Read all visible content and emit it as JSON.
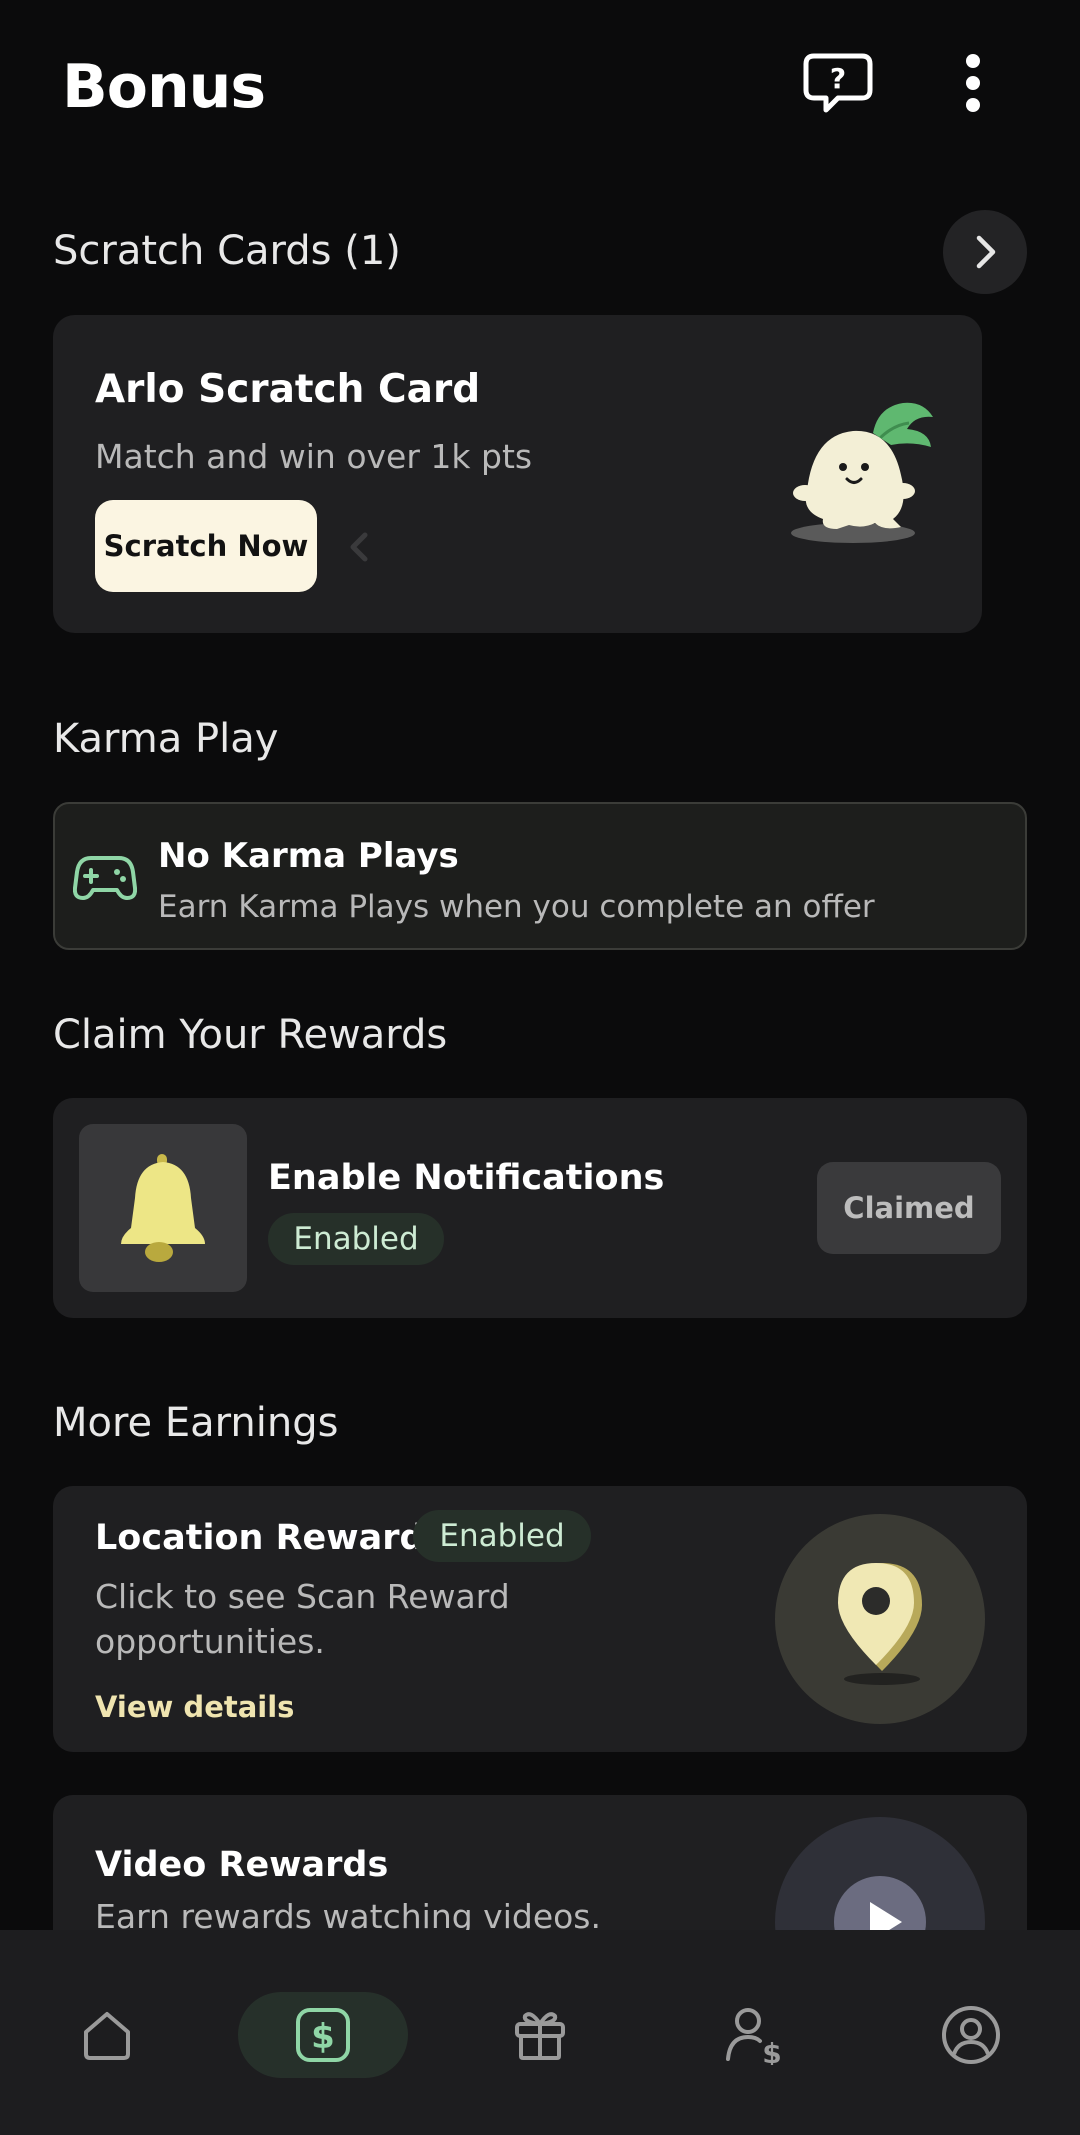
{
  "header": {
    "title": "Bonus",
    "help_icon": "help-chat-icon",
    "menu_icon": "more-vertical-icon"
  },
  "scratch_section": {
    "title": "Scratch Cards (1)",
    "chevron_icon": "chevron-right-icon",
    "card": {
      "title": "Arlo Scratch Card",
      "subtitle": "Match and win over 1k pts",
      "button_label": "Scratch Now",
      "mascot_icon": "radish-mascot-icon"
    }
  },
  "karma_section": {
    "title": "Karma Play",
    "box_title": "No Karma Plays",
    "box_subtitle": "Earn Karma Plays when you complete an offer",
    "icon": "gamepad-icon"
  },
  "rewards_section": {
    "title": "Claim Your Rewards",
    "item": {
      "title": "Enable Notifications",
      "badge": "Enabled",
      "button_label": "Claimed",
      "icon": "bell-icon"
    }
  },
  "earnings_section": {
    "title": "More Earnings",
    "location": {
      "title": "Location Rewards",
      "badge": "Enabled",
      "subtitle": "Click to see Scan Reward opportunities.",
      "link": "View details",
      "icon": "map-pin-icon"
    },
    "video": {
      "title": "Video Rewards",
      "subtitle": "Earn rewards watching videos.",
      "icon": "play-icon"
    }
  },
  "bottom_nav": {
    "items": [
      {
        "icon": "home-icon",
        "active": false
      },
      {
        "icon": "dollar-icon",
        "active": true
      },
      {
        "icon": "gift-icon",
        "active": false
      },
      {
        "icon": "user-dollar-icon",
        "active": false
      },
      {
        "icon": "profile-icon",
        "active": false
      }
    ]
  },
  "colors": {
    "background": "#0b0b0c",
    "card": "#1f1f21",
    "accent_green": "#8fd6a6",
    "accent_cream": "#fbf5e2",
    "link_yellow": "#efe4b0"
  }
}
